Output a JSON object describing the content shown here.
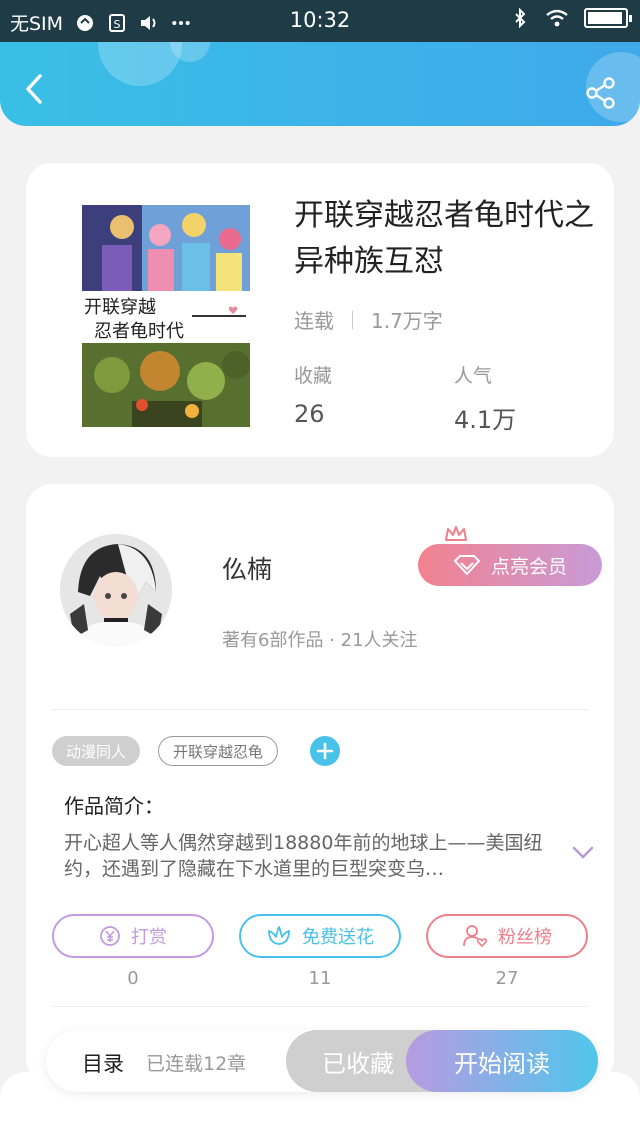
{
  "status_bar": {
    "carrier": "无SIM",
    "time": "10:32"
  },
  "header": {
    "back_icon": "chevron-left-icon",
    "share_icon": "share-icon"
  },
  "book": {
    "title": "开联穿越忍者龟时代之异种族互怼",
    "cover_title_line1": "开联穿越",
    "cover_title_line2": "忍者龟时代",
    "status": "连载",
    "word_count": "1.7万字",
    "favorites_label": "收藏",
    "favorites_value": "26",
    "popularity_label": "人气",
    "popularity_value": "4.1万"
  },
  "author": {
    "name": "仫楠",
    "summary": "著有6部作品 · 21人关注",
    "vip_button": "点亮会员"
  },
  "tags": [
    "动漫同人",
    "开联穿越忍龟"
  ],
  "intro": {
    "label": "作品简介：",
    "text": "开心超人等人偶然穿越到18880年前的地球上——美国纽约，还遇到了隐藏在下水道里的巨型突变乌…"
  },
  "actions": [
    {
      "label": "打赏",
      "count": "0",
      "icon": "yen-icon",
      "color": "#c39be0"
    },
    {
      "label": "免费送花",
      "count": "11",
      "icon": "flower-icon",
      "color": "#49c2ea"
    },
    {
      "label": "粉丝榜",
      "count": "27",
      "icon": "fans-icon",
      "color": "#ef7f8a"
    }
  ],
  "bottom_bar": {
    "toc_label": "目录",
    "toc_count": "已连载12章",
    "collected_button": "已收藏",
    "read_button": "开始阅读"
  }
}
